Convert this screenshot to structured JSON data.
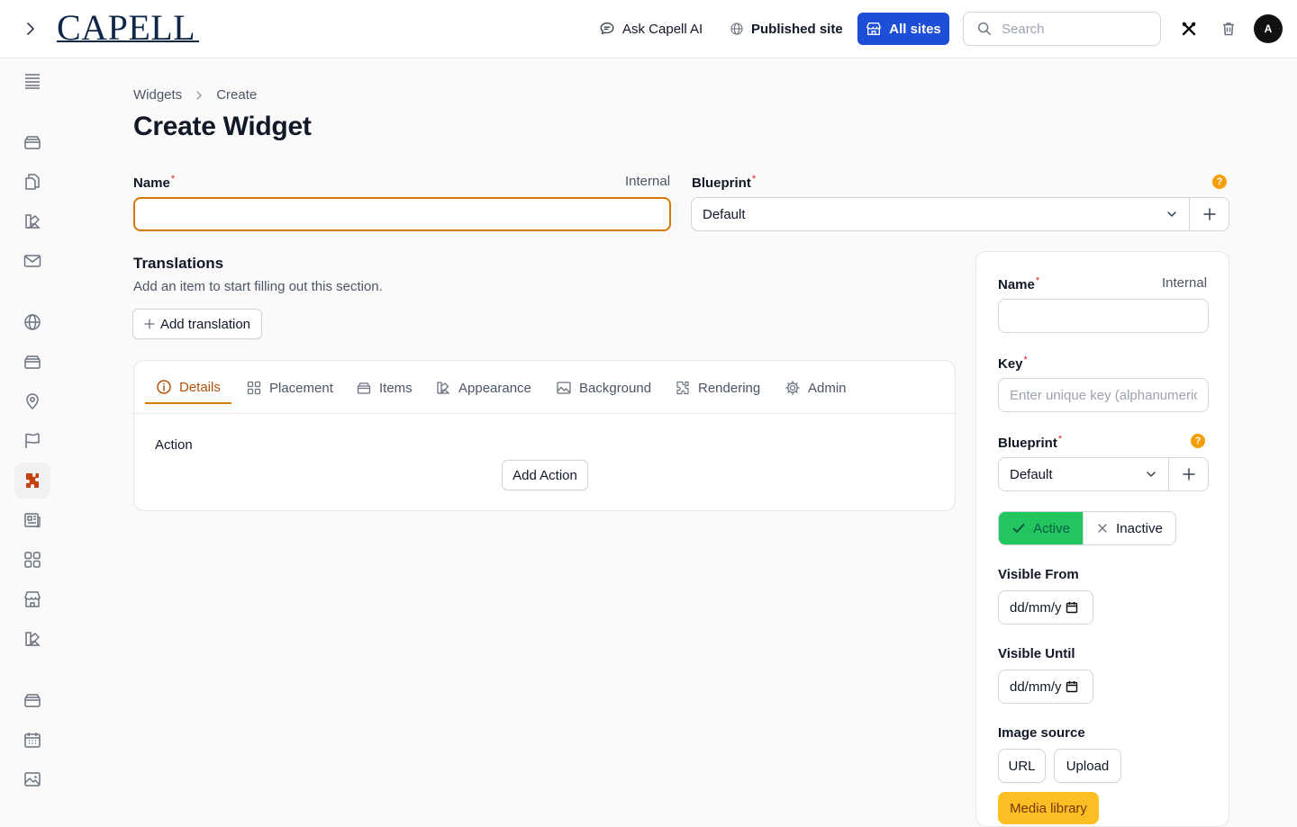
{
  "brand": {
    "logo_text": "CAPELL"
  },
  "topbar": {
    "ask_label": "Ask Capell AI",
    "published_label": "Published site",
    "all_sites_label": "All sites",
    "search_placeholder": "Search",
    "avatar_initial": "A"
  },
  "sidebar": {
    "icons": [
      "list-icon",
      "archive-icon",
      "documents-icon",
      "swatch-icon",
      "mail-icon",
      "globe-icon",
      "archive-icon",
      "map-pin-icon",
      "flag-icon",
      "puzzle-icon",
      "newspaper-icon",
      "squares-icon",
      "storefront-icon",
      "swatch-icon",
      "archive-icon",
      "calendar-icon",
      "photo-icon"
    ],
    "active": "puzzle-icon"
  },
  "breadcrumb": {
    "parent": "Widgets",
    "current": "Create"
  },
  "page": {
    "title": "Create Widget"
  },
  "form": {
    "name_label": "Name",
    "name_hint": "Internal",
    "name_value": "",
    "blueprint_label": "Blueprint",
    "blueprint_value": "Default"
  },
  "translations": {
    "title": "Translations",
    "description": "Add an item to start filling out this section.",
    "add_label": "Add translation"
  },
  "tabs": {
    "items": [
      {
        "label": "Details",
        "icon": "info-icon",
        "active": true
      },
      {
        "label": "Placement",
        "icon": "squares-icon",
        "active": false
      },
      {
        "label": "Items",
        "icon": "archive-icon",
        "active": false
      },
      {
        "label": "Appearance",
        "icon": "swatch-icon",
        "active": false
      },
      {
        "label": "Background",
        "icon": "photo-icon",
        "active": false
      },
      {
        "label": "Rendering",
        "icon": "puzzle-icon",
        "active": false
      },
      {
        "label": "Admin",
        "icon": "gear-icon",
        "active": false
      }
    ],
    "action_label": "Action",
    "add_action_label": "Add Action"
  },
  "side_form": {
    "name_label": "Name",
    "name_hint": "Internal",
    "name_value": "",
    "key_label": "Key",
    "key_placeholder": "Enter unique key (alphanumeric",
    "blueprint_label": "Blueprint",
    "blueprint_value": "Default",
    "active_label": "Active",
    "inactive_label": "Inactive",
    "status": "active",
    "visible_from_label": "Visible From",
    "visible_from_value": "dd/mm/y",
    "visible_until_label": "Visible Until",
    "visible_until_value": "dd/mm/y",
    "image_source_label": "Image source",
    "url_label": "URL",
    "upload_label": "Upload",
    "media_library_label": "Media library"
  },
  "colors": {
    "primary": "#1d4ed8",
    "accent": "#d97706",
    "active_green": "#22c55e",
    "warning": "#f59e0b",
    "required": "#dc2626"
  }
}
